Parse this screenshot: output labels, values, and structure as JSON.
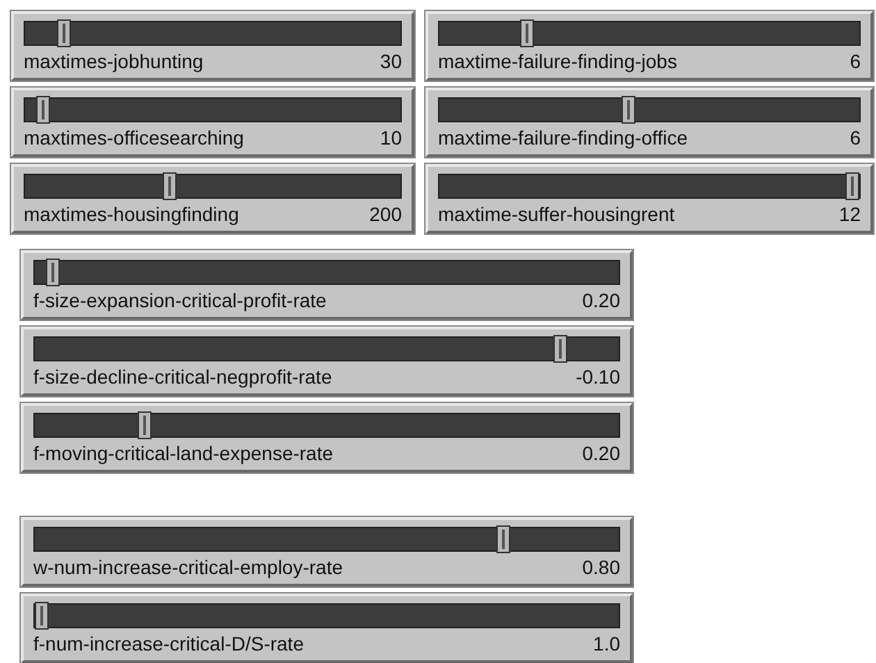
{
  "top_grid": [
    {
      "label": "maxtimes-jobhunting",
      "value": "30",
      "level": 0.09
    },
    {
      "label": "maxtime-failure-finding-jobs",
      "value": "6",
      "level": 0.2
    },
    {
      "label": "maxtimes-officesearching",
      "value": "10",
      "level": 0.03
    },
    {
      "label": "maxtime-failure-finding-office",
      "value": "6",
      "level": 0.45
    },
    {
      "label": "maxtimes-housingfinding",
      "value": "200",
      "level": 0.38
    },
    {
      "label": "maxtime-suffer-housingrent",
      "value": "12",
      "level": 1.0
    }
  ],
  "groups": [
    {
      "sliders": [
        {
          "label": "f-size-expansion-critical-profit-rate",
          "value": "0.20",
          "level": 0.02
        },
        {
          "label": "f-size-decline-critical-negprofit-rate",
          "value": "-0.10",
          "level": 0.91
        },
        {
          "label": "f-moving-critical-land-expense-rate",
          "value": "0.20",
          "level": 0.18
        }
      ]
    },
    {
      "sliders": [
        {
          "label": "w-num-increase-critical-employ-rate",
          "value": "0.80",
          "level": 0.81
        },
        {
          "label": "f-num-increase-critical-D/S-rate",
          "value": "1.0",
          "level": 0.0
        }
      ]
    }
  ]
}
